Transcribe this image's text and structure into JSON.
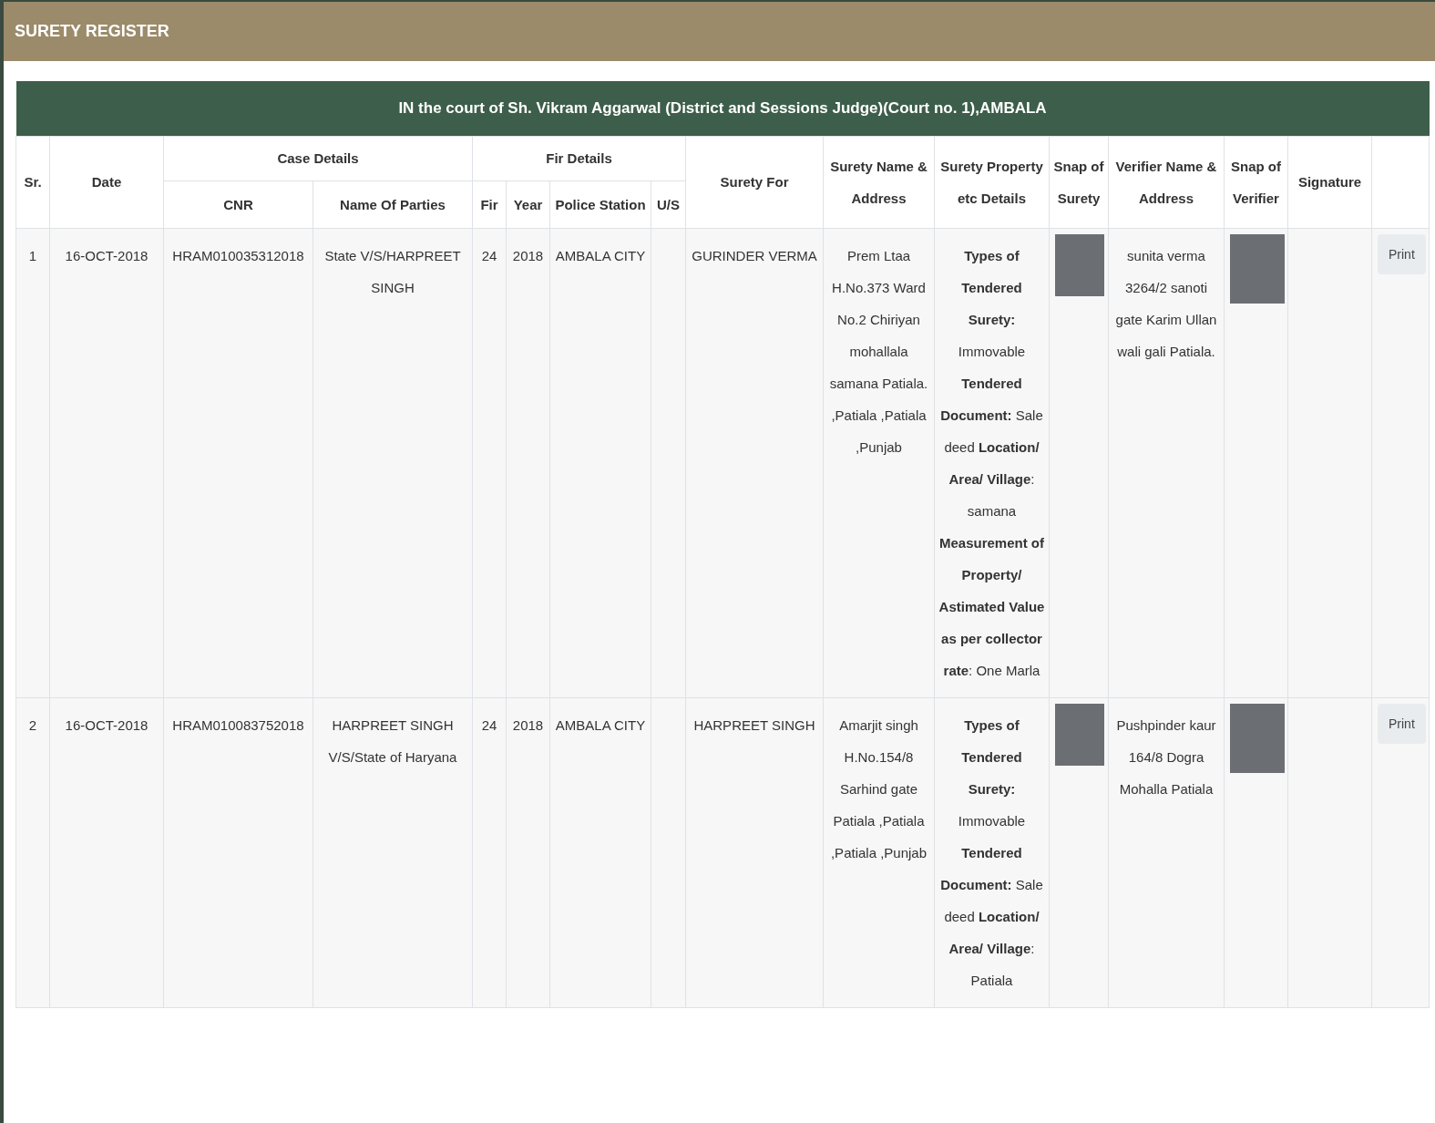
{
  "panel": {
    "title": "SURETY REGISTER"
  },
  "court_title": "IN the court of Sh. Vikram Aggarwal (District and Sessions Judge)(Court no. 1),AMBALA",
  "columns": [
    {
      "label": "Sr."
    },
    {
      "label": "Date"
    },
    {
      "label": "Case Details",
      "children": [
        {
          "label": "CNR"
        },
        {
          "label": "Name Of Parties"
        }
      ]
    },
    {
      "label": "Fir Details",
      "children": [
        {
          "label": "Fir"
        },
        {
          "label": "Year"
        },
        {
          "label": "Police Station"
        },
        {
          "label": "U/S"
        }
      ]
    },
    {
      "label": "Surety For"
    },
    {
      "label": "Surety Name & Address"
    },
    {
      "label": "Surety Property etc Details"
    },
    {
      "label": "Snap of Surety"
    },
    {
      "label": "Verifier Name & Address"
    },
    {
      "label": "Snap of Verifier"
    },
    {
      "label": "Signature"
    }
  ],
  "rows": [
    {
      "sr": "1",
      "date": "16-OCT-2018",
      "cnr": "HRAM010035312018",
      "parties": "State V/S/HARPREET SINGH",
      "fir": "24",
      "year": "2018",
      "police_station": "AMBALA CITY",
      "surety_for": "GURINDER VERMA",
      "surety_address": "Prem Ltaa H.No.373 Ward No.2 Chiriyan mohallala samana Patiala. ,Patiala ,Patiala ,Punjab",
      "property": "**Types of Tendered Surety:** Immovable **Tendered Document:** Sale deed **Location/ Area/ Village**: samana **Measurement of Property/ Astimated Value as per collector rate**: One Marla",
      "verifier": "sunita verma 3264/2 sanoti gate Karim Ullan wali gali Patiala.",
      "print": "Print"
    },
    {
      "sr": "2",
      "date": "16-OCT-2018",
      "cnr": "HRAM010083752018",
      "parties": "HARPREET SINGH V/S/State of Haryana",
      "fir": "24",
      "year": "2018",
      "police_station": "AMBALA CITY",
      "surety_for": "HARPREET SINGH",
      "surety_address": "Amarjit singh H.No.154/8 Sarhind gate Patiala ,Patiala ,Patiala ,Punjab",
      "property": "**Types of Tendered Surety:** Immovable **Tendered Document:** Sale deed **Location/ Area/ Village**: Patiala",
      "verifier": "Pushpinder kaur 164/8 Dogra Mohalla Patiala",
      "print": "Print"
    }
  ]
}
